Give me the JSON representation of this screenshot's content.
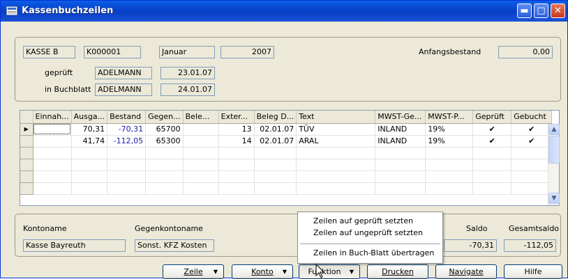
{
  "window": {
    "title": "Kassenbuchzeilen"
  },
  "header": {
    "kasse": "KASSE B",
    "beleg_nr": "K000001",
    "monat": "Januar",
    "jahr": "2007",
    "anfangsbestand_label": "Anfangsbestand",
    "anfangsbestand_value": "0,00",
    "geprueft_label": "geprüft",
    "geprueft_user": "ADELMANN",
    "geprueft_date": "23.01.07",
    "buchblatt_label": "in Buchblatt",
    "buchblatt_user": "ADELMANN",
    "buchblatt_date": "24.01.07"
  },
  "grid": {
    "columns": [
      "Einnah...",
      "Ausga...",
      "Bestand",
      "Gegen...",
      "Bele...",
      "Exter...",
      "Beleg D...",
      "Text",
      "MWST-Ge...",
      "MWST-P...",
      "Geprüft",
      "Gebucht"
    ],
    "rows": [
      {
        "einnahme": "",
        "ausgabe": "70,31",
        "bestand": "-70,31",
        "gegenkonto": "65700",
        "beleg": "",
        "extern": "13",
        "beleg_datum": "02.01.07",
        "text": "TÜV",
        "mwst_ge": "INLAND",
        "mwst_p": "19%",
        "geprueft": "✔",
        "gebucht": "✔"
      },
      {
        "einnahme": "",
        "ausgabe": "41,74",
        "bestand": "-112,05",
        "gegenkonto": "65300",
        "beleg": "",
        "extern": "14",
        "beleg_datum": "02.01.07",
        "text": "ARAL",
        "mwst_ge": "INLAND",
        "mwst_p": "19%",
        "geprueft": "✔",
        "gebucht": "✔"
      }
    ]
  },
  "footer": {
    "kontoname_label": "Kontoname",
    "kontoname_value": "Kasse Bayreuth",
    "gegenkontoname_label": "Gegenkontoname",
    "gegenkontoname_value": "Sonst. KFZ Kosten",
    "saldo_label": "Saldo",
    "saldo_value": "-70,31",
    "gesamtsaldo_label": "Gesamtsaldo",
    "gesamtsaldo_value": "-112,05"
  },
  "menu": {
    "items": [
      "Zeilen auf geprüft setzten",
      "Zeilen auf ungeprüft setzten",
      "Zeilen in Buch-Blatt übertragen"
    ]
  },
  "buttons": {
    "zeile": "Zeile",
    "konto": "Konto",
    "funktion": "Funktion",
    "drucken": "Drucken",
    "navigate": "Navigate",
    "hilfe": "Hilfe"
  },
  "colors": {
    "titlebar": "#0842c9",
    "window_bg": "#ece9d8",
    "negative_amount": "#1a1aa8"
  }
}
